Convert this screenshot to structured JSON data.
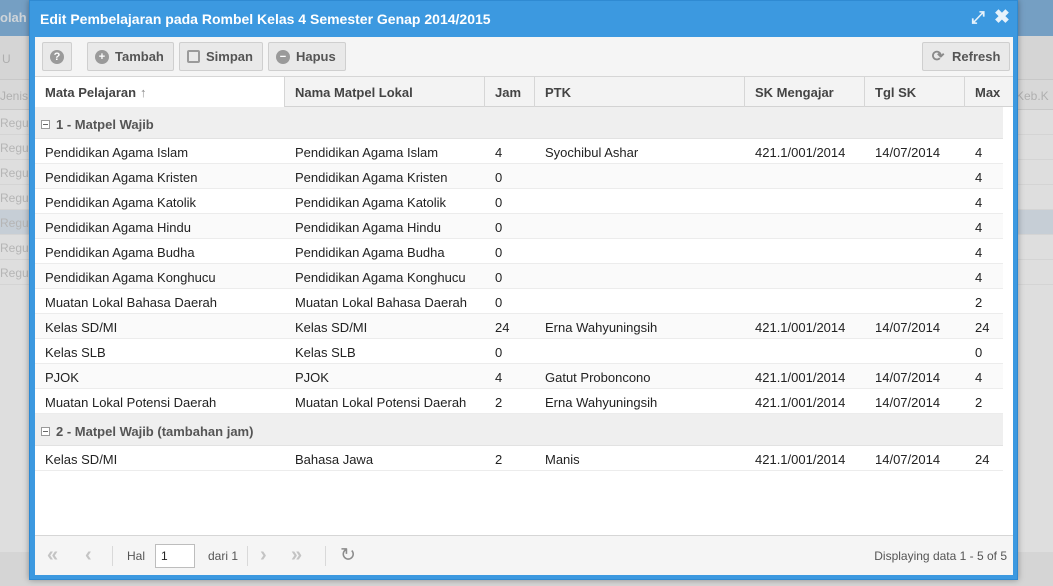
{
  "background": {
    "title_fragment": "olah",
    "toolbar_fragment": "U",
    "head_left": "Jenis",
    "head_right": "Keb.K",
    "rows": [
      "Regul",
      "Regul",
      "Regul",
      "Regul",
      "Regul",
      "Regul",
      "Regul"
    ]
  },
  "window": {
    "title": "Edit Pembelajaran pada Rombel Kelas 4 Semester Genap 2014/2015",
    "maximize_icon": "expand-icon",
    "close_icon": "close-icon"
  },
  "toolbar": {
    "help_label": "?",
    "add_label": "Tambah",
    "save_label": "Simpan",
    "delete_label": "Hapus",
    "refresh_label": "Refresh"
  },
  "columns": [
    "Mata Pelajaran",
    "Nama Matpel Lokal",
    "Jam",
    "PTK",
    "SK Mengajar",
    "Tgl SK",
    "Max"
  ],
  "groups": [
    {
      "label": "1 - Matpel Wajib",
      "rows": [
        [
          "Pendidikan Agama Islam",
          "Pendidikan Agama Islam",
          "4",
          "Syochibul Ashar",
          "421.1/001/2014",
          "14/07/2014",
          "4"
        ],
        [
          "Pendidikan Agama Kristen",
          "Pendidikan Agama Kristen",
          "0",
          "",
          "",
          "",
          "4"
        ],
        [
          "Pendidikan Agama Katolik",
          "Pendidikan Agama Katolik",
          "0",
          "",
          "",
          "",
          "4"
        ],
        [
          "Pendidikan Agama Hindu",
          "Pendidikan Agama Hindu",
          "0",
          "",
          "",
          "",
          "4"
        ],
        [
          "Pendidikan Agama Budha",
          "Pendidikan Agama Budha",
          "0",
          "",
          "",
          "",
          "4"
        ],
        [
          "Pendidikan Agama Konghucu",
          "Pendidikan Agama Konghucu",
          "0",
          "",
          "",
          "",
          "4"
        ],
        [
          "Muatan Lokal Bahasa Daerah",
          "Muatan Lokal Bahasa Daerah",
          "0",
          "",
          "",
          "",
          "2"
        ],
        [
          "Kelas SD/MI",
          "Kelas SD/MI",
          "24",
          "Erna Wahyuningsih",
          "421.1/001/2014",
          "14/07/2014",
          "24"
        ],
        [
          "Kelas SLB",
          "Kelas SLB",
          "0",
          "",
          "",
          "",
          "0"
        ],
        [
          "PJOK",
          "PJOK",
          "4",
          "Gatut Proboncono",
          "421.1/001/2014",
          "14/07/2014",
          "4"
        ],
        [
          "Muatan Lokal Potensi Daerah",
          "Muatan Lokal Potensi Daerah",
          "2",
          "Erna Wahyuningsih",
          "421.1/001/2014",
          "14/07/2014",
          "2"
        ]
      ]
    },
    {
      "label": "2 - Matpel Wajib (tambahan jam)",
      "rows": [
        [
          "Kelas SD/MI",
          "Bahasa Jawa",
          "2",
          "Manis",
          "421.1/001/2014",
          "14/07/2014",
          "24"
        ]
      ]
    }
  ],
  "pager": {
    "page_label": "Hal",
    "page_value": "1",
    "of_label": "dari 1",
    "display_text": "Displaying data 1 - 5 of 5"
  }
}
